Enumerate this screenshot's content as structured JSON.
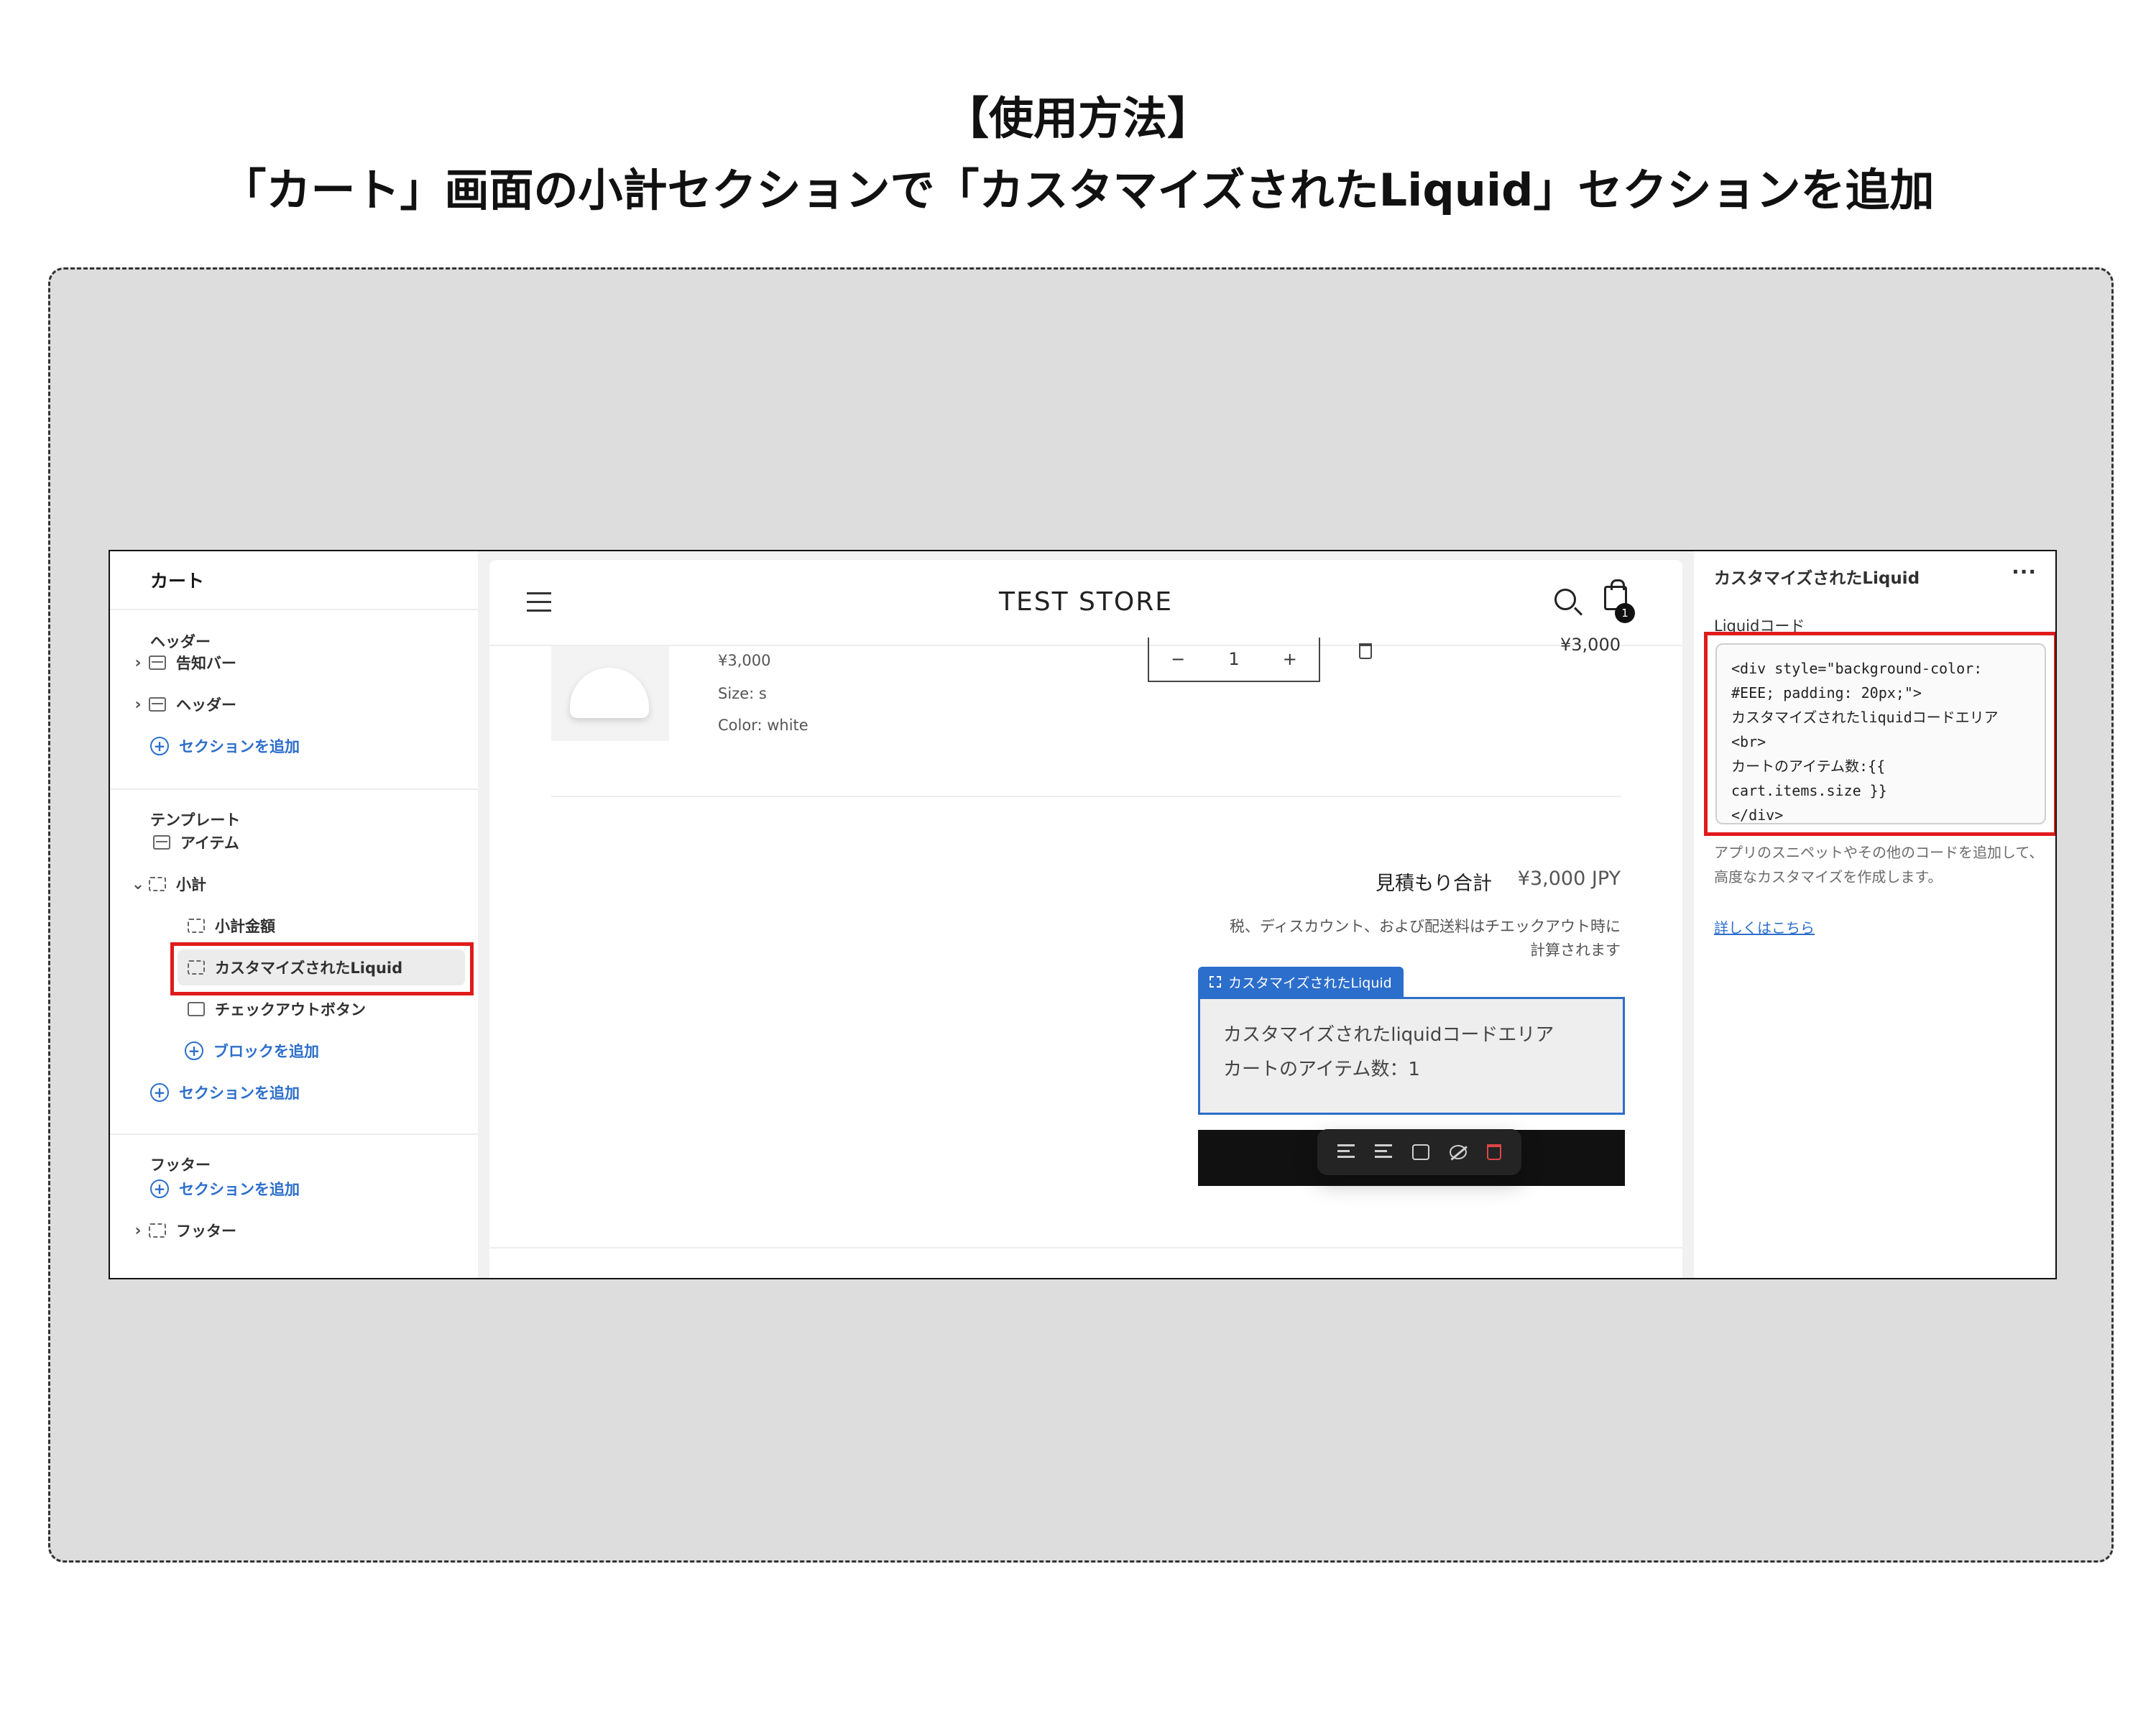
{
  "heading": {
    "line1": "【使用方法】",
    "line2": "「カート」画面の小計セクションで「カスタマイズされたLiquid」セクションを追加"
  },
  "colors": {
    "accent": "#2c6ecb",
    "highlight": "#e01b1b",
    "canvas": "#dddddd"
  },
  "left_panel": {
    "title": "カート",
    "header_group": "ヘッダー",
    "header_items": [
      "告知バー",
      "ヘッダー"
    ],
    "add_section": "セクションを追加",
    "template_group": "テンプレート",
    "template_items": {
      "item": "アイテム",
      "subtotal": "小計"
    },
    "subtotal_children": [
      "小計金額",
      "カスタマイズされたLiquid",
      "チェックアウトボタン"
    ],
    "add_block": "ブロックを追加",
    "footer_group": "フッター",
    "footer_item": "フッター"
  },
  "preview": {
    "store_name": "TEST STORE",
    "cart_count": "1",
    "product": {
      "price": "¥3,000",
      "size": "Size: s",
      "color": "Color: white",
      "line_total": "¥3,000"
    },
    "quantity": {
      "minus": "−",
      "value": "1",
      "plus": "+"
    },
    "estimated_total_label": "見積もり合計",
    "estimated_total_value": "¥3,000 JPY",
    "tax_note_1": "税、ディスカウント、および配送料はチエックアウト時に",
    "tax_note_2": "計算されます",
    "block_tag": "カスタマイズされたLiquid",
    "liquid_output_1": "カスタマイズされたliquidコードエリア",
    "liquid_output_2": "カートのアイテム数：1"
  },
  "right_panel": {
    "title": "カスタマイズされたLiquid",
    "more": "···",
    "code_label": "Liquidコード",
    "code": "<div style=\"background-color:\n#EEE; padding: 20px;\">\nカスタマイズされたliquidコードエリア\n<br>\nカートのアイテム数:{{\ncart.items.size }}\n</div>",
    "help": "アプリのスニペットやその他のコードを追加して、高度なカスタマイズを作成します。",
    "learn_more": "詳しくはこちら"
  },
  "icons": [
    "chevron-right-icon",
    "chevron-down-icon",
    "section-icon",
    "plus-circle-icon",
    "menu-icon",
    "search-icon",
    "cart-icon",
    "trash-icon",
    "move-up-icon",
    "move-down-icon",
    "duplicate-icon",
    "hide-icon",
    "more-icon"
  ]
}
